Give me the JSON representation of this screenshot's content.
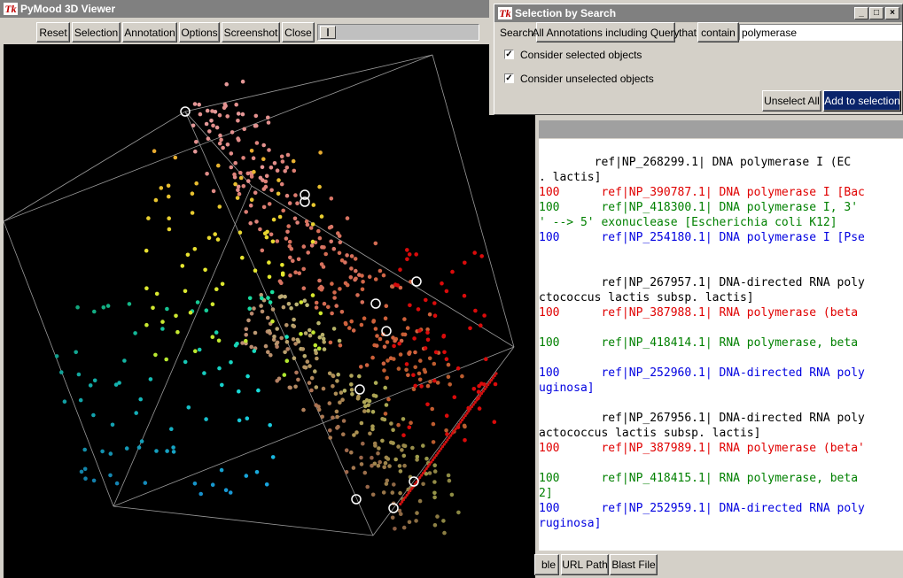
{
  "viewer": {
    "title": "PyMood 3D Viewer",
    "buttons": [
      "Reset",
      "Selection",
      "Annotation",
      "Options",
      "Screenshot",
      "Close"
    ]
  },
  "search_dialog": {
    "title": "Selection by Search",
    "search_label": "Search:",
    "scope_button": "All Annotations including Query",
    "that_label": "that",
    "op_button": "contain",
    "query_value": "polymerase",
    "check_selected": {
      "label": "Consider selected objects",
      "checked": true
    },
    "check_unselected": {
      "label": "Consider unselected objects",
      "checked": true
    },
    "unselect_all": "Unselect All",
    "add_to_selection": "Add to selection"
  },
  "log_lines": [
    {
      "color": "black",
      "text": "        ref|NP_268299.1| DNA polymerase I (EC "
    },
    {
      "color": "black",
      "text": ". lactis]"
    },
    {
      "color": "red",
      "text": "100      ref|NP_390787.1| DNA polymerase I [Bac"
    },
    {
      "color": "green",
      "text": "100      ref|NP_418300.1| DNA polymerase I, 3'"
    },
    {
      "color": "green",
      "text": "' --> 5' exonuclease [Escherichia coli K12]"
    },
    {
      "color": "blue",
      "text": "100      ref|NP_254180.1| DNA polymerase I [Pse"
    },
    {
      "color": "black",
      "text": ""
    },
    {
      "color": "black",
      "text": ""
    },
    {
      "color": "black",
      "text": "         ref|NP_267957.1| DNA-directed RNA poly"
    },
    {
      "color": "black",
      "text": "ctococcus lactis subsp. lactis]"
    },
    {
      "color": "red",
      "text": "100      ref|NP_387988.1| RNA polymerase (beta "
    },
    {
      "color": "black",
      "text": ""
    },
    {
      "color": "green",
      "text": "100      ref|NP_418414.1| RNA polymerase, beta "
    },
    {
      "color": "black",
      "text": ""
    },
    {
      "color": "blue",
      "text": "100      ref|NP_252960.1| DNA-directed RNA poly"
    },
    {
      "color": "blue",
      "text": "uginosa]"
    },
    {
      "color": "black",
      "text": ""
    },
    {
      "color": "black",
      "text": "         ref|NP_267956.1| DNA-directed RNA poly"
    },
    {
      "color": "black",
      "text": "actococcus lactis subsp. lactis]"
    },
    {
      "color": "red",
      "text": "100      ref|NP_387989.1| RNA polymerase (beta'"
    },
    {
      "color": "black",
      "text": ""
    },
    {
      "color": "green",
      "text": "100      ref|NP_418415.1| RNA polymerase, beta "
    },
    {
      "color": "green",
      "text": "2]"
    },
    {
      "color": "blue",
      "text": "100      ref|NP_252959.1| DNA-directed RNA poly"
    },
    {
      "color": "blue",
      "text": "ruginosa]"
    }
  ],
  "bottom_tabs": [
    "ble",
    "URL Path",
    "Blast File"
  ],
  "colors": {
    "selected_button": "#0a246a",
    "inactive_title": "#808080"
  }
}
